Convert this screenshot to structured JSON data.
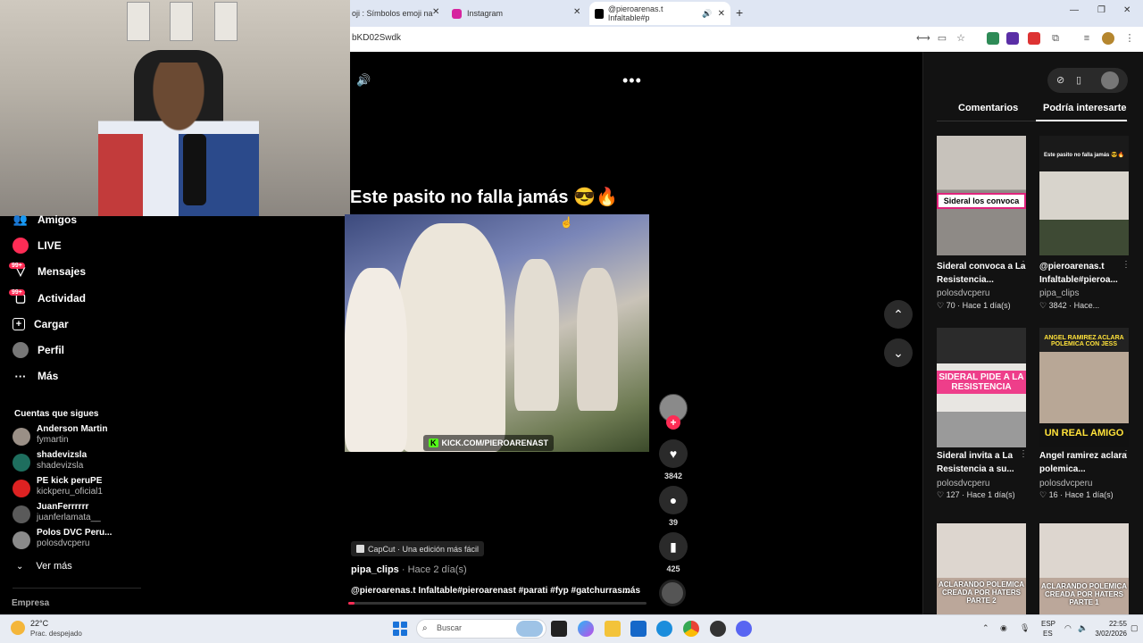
{
  "browser": {
    "tabs": [
      {
        "label": "oji : Símbolos emoji na"
      },
      {
        "label": "Instagram"
      },
      {
        "label": "@pieroarenas.t Infaltable#p"
      }
    ],
    "new_tab": "+",
    "url": "bKD02Swdk"
  },
  "sidebar": {
    "items": [
      {
        "label": "Amigos",
        "icon": "friends-icon"
      },
      {
        "label": "LIVE",
        "icon": "live-icon"
      },
      {
        "label": "Mensajes",
        "icon": "messages-icon",
        "badge": "99+"
      },
      {
        "label": "Actividad",
        "icon": "activity-icon",
        "badge": "99+"
      },
      {
        "label": "Cargar",
        "icon": "upload-icon"
      },
      {
        "label": "Perfil",
        "icon": "profile-icon"
      },
      {
        "label": "Más",
        "icon": "more-icon"
      }
    ],
    "following_title": "Cuentas que sigues",
    "following": [
      {
        "name": "Anderson Martin",
        "handle": "fymartin"
      },
      {
        "name": "shadevizsla",
        "handle": "shadevizsla"
      },
      {
        "name": "PE kick peruPE",
        "handle": "kickperu_oficial1"
      },
      {
        "name": "JuanFerrrrrr",
        "handle": "juanferlamata__"
      },
      {
        "name": "Polos DVC Peru...",
        "handle": "polosdvcperu"
      }
    ],
    "see_more": "Ver más",
    "footer": "Empresa"
  },
  "video": {
    "caption": "Este pasito no falla jamás 😎🔥",
    "watermark": "KICK.COM/PIEROARENAST",
    "likes": "3842",
    "comments": "39",
    "saves": "425",
    "effect": "CapCut · Una edición más fácil",
    "author": "pipa_clips",
    "time": "· Hace 2 día(s)",
    "description": "@pieroarenas.t Infaltable#pieroarenast #parati #fyp #gatchurras...",
    "more": "más",
    "progress_fraction": 0.02
  },
  "right_panel": {
    "tabs": [
      "Comentarios",
      "Podría interesarte"
    ],
    "cards": [
      {
        "thumb_text": "Sideral los convoca",
        "title": "Sideral convoca a La Resistencia...",
        "author": "polosdvcperu",
        "likes": "70",
        "time": "Hace 1 día(s)"
      },
      {
        "thumb_text": "Este pasito no falla jamás 😎🔥",
        "title": "@pieroarenas.t Infaltable#pieroa...",
        "author": "pipa_clips",
        "likes": "3842",
        "time": "Hace..."
      },
      {
        "thumb_text": "SIDERAL PIDE A LA RESISTENCIA",
        "title": "Sideral invita a La Resistencia a su...",
        "author": "polosdvcperu",
        "likes": "127",
        "time": "Hace 1 día(s)"
      },
      {
        "thumb_text": "UN REAL AMIGO",
        "thumb_text_top": "ANGEL RAMIREZ ACLARA POLEMICA CON JESS",
        "title": "Angel ramirez aclara polemica...",
        "author": "polosdvcperu",
        "likes": "16",
        "time": "Hace 1 día(s)"
      },
      {
        "thumb_text": "ACLARANDO POLEMICA CREADA POR HATERS PARTE 2"
      },
      {
        "thumb_text": "ACLARANDO POLEMICA CREADA POR HATERS PARTE 1"
      }
    ]
  },
  "taskbar": {
    "weather_temp": "22°C",
    "weather_desc": "Prac. despejado",
    "search_placeholder": "Buscar",
    "lang1": "ESP",
    "lang2": "ES",
    "time": "22:55",
    "date": "3/02/2026"
  },
  "colors": {
    "accent": "#fe2c55",
    "kick": "#53fc18"
  }
}
